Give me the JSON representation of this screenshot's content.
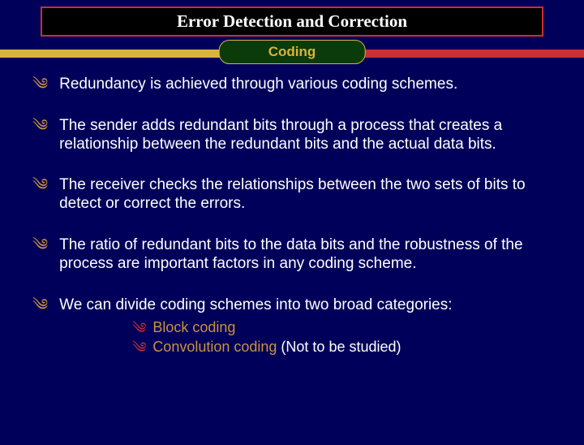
{
  "header": {
    "title": "Error Detection and Correction",
    "subtitle": "Coding"
  },
  "points": [
    "Redundancy is achieved through various coding schemes.",
    "The sender adds redundant bits through a process that creates a relationship between the redundant bits and the actual data bits.",
    "The receiver checks the relationships between the two sets of bits to detect or correct the errors.",
    "The ratio of redundant bits to the data bits and the robustness of the process are important factors in any coding scheme.",
    "We can divide coding schemes into two broad categories:"
  ],
  "sub": [
    {
      "label": "Block coding",
      "aside": ""
    },
    {
      "label": "Convolution coding ",
      "aside": "(Not to be studied)"
    }
  ],
  "glyph": "༄"
}
